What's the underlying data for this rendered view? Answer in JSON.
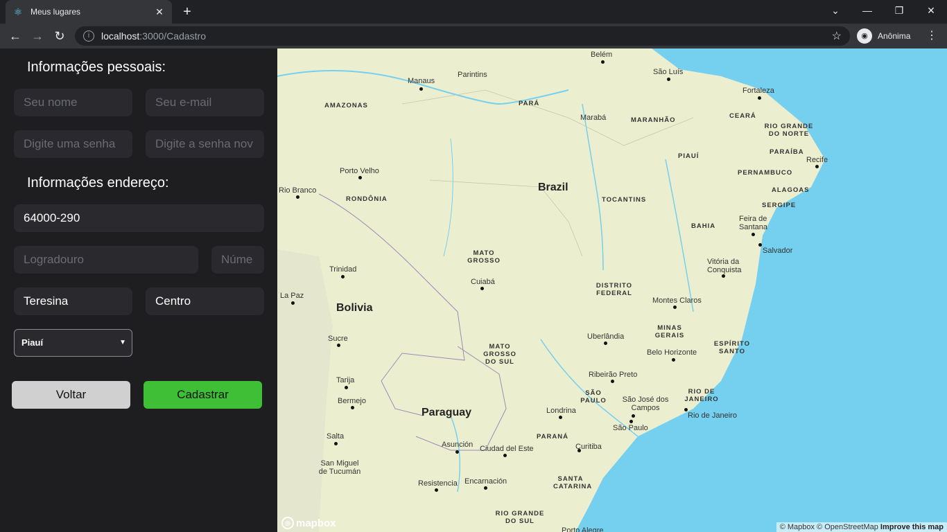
{
  "browser": {
    "tab_title": "Meus lugares",
    "url_host": "localhost",
    "url_path": ":3000/Cadastro",
    "profile_label": "Anônima"
  },
  "form": {
    "personal_heading": "Informações pessoais:",
    "name_placeholder": "Seu nome",
    "email_placeholder": "Seu e-mail",
    "password_placeholder": "Digite uma senha",
    "password_confirm_placeholder": "Digite a senha nov",
    "address_heading": "Informações endereço:",
    "cep_value": "64000-290",
    "street_placeholder": "Logradouro",
    "number_placeholder": "Núme",
    "city_value": "Teresina",
    "district_value": "Centro",
    "state_selected": "Piauí",
    "back_label": "Voltar",
    "submit_label": "Cadastrar"
  },
  "map": {
    "countries": [
      "Brazil",
      "Bolivia",
      "Paraguay"
    ],
    "states": [
      "AMAZONAS",
      "PARÁ",
      "MARANHÃO",
      "CEARÁ",
      "RIO GRANDE DO NORTE",
      "PARAÍBA",
      "PIAUÍ",
      "PERNAMBUCO",
      "ALAGOAS",
      "SERGIPE",
      "TOCANTINS",
      "RONDÔNIA",
      "BAHIA",
      "MATO GROSSO",
      "DISTRITO FEDERAL",
      "MINAS GERAIS",
      "ESPÍRITO SANTO",
      "MATO GROSSO DO SUL",
      "SÃO PAULO",
      "RIO DE JANEIRO",
      "PARANÁ",
      "SANTA CATARINA",
      "RIO GRANDE DO SUL"
    ],
    "cities": [
      "Belém",
      "São Luís",
      "Manaus",
      "Parintins",
      "Fortaleza",
      "Marabá",
      "Recife",
      "Porto Velho",
      "Rio Branco",
      "Feira de Santana",
      "Salvador",
      "Trinidad",
      "Cuiabá",
      "Vitória da Conquista",
      "La Paz",
      "Montes Claros",
      "Sucre",
      "Uberlândia",
      "Belo Horizonte",
      "Tarija",
      "Ribeirão Preto",
      "Bermejo",
      "São José dos Campos",
      "Rio de Janeiro",
      "Londrina",
      "São Paulo",
      "Salta",
      "Asunción",
      "Ciudad del Este",
      "Curitiba",
      "San Miguel de Tucumán",
      "Resistencia",
      "Encarnación",
      "Porto Alegre"
    ],
    "logo": "mapbox",
    "attribution": "© Mapbox © OpenStreetMap",
    "improve_link": "Improve this map"
  },
  "colors": {
    "panel_bg": "#1e1e20",
    "input_bg": "#29292e",
    "submit_green": "#3fbf35",
    "back_gray": "#d0d0d0",
    "ocean": "#75cfee",
    "land": "#ecefcf"
  }
}
